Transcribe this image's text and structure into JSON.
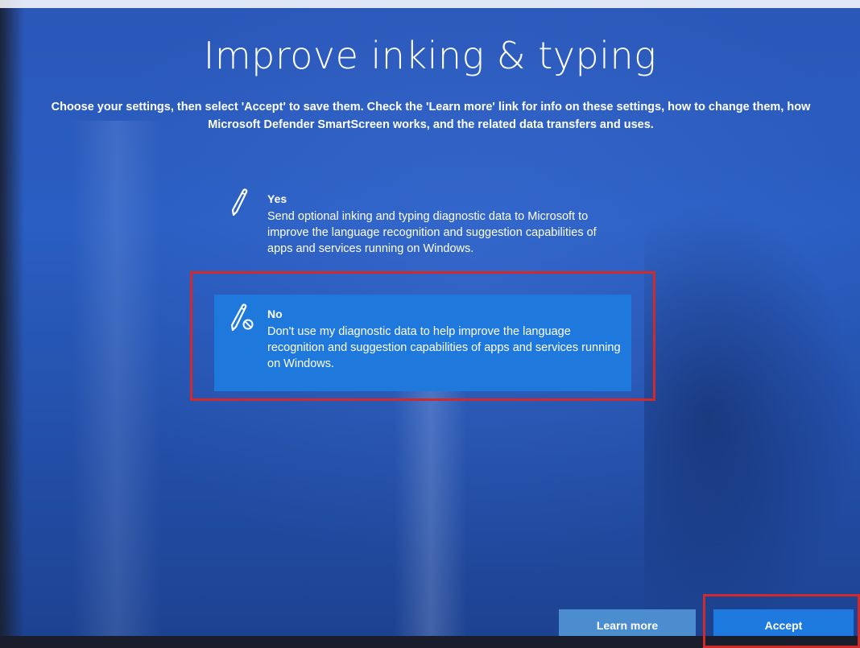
{
  "page": {
    "title": "Improve inking & typing",
    "subtitle": "Choose your settings, then select 'Accept' to save them. Check the 'Learn more' link for info on these settings, how to change them, how Microsoft Defender SmartScreen works, and the related data transfers and uses."
  },
  "options": [
    {
      "label": "Yes",
      "description": "Send optional inking and typing diagnostic data to Microsoft to improve the language recognition and suggestion capabilities of apps and services running on Windows.",
      "icon": "pen-icon",
      "selected": false
    },
    {
      "label": "No",
      "description": "Don't use my diagnostic data to help improve the language recognition and suggestion capabilities of apps and services running on Windows.",
      "icon": "pen-blocked-icon",
      "selected": true
    }
  ],
  "buttons": {
    "learn_more": "Learn more",
    "accept": "Accept"
  },
  "colors": {
    "background": "#2a5ec2",
    "selected_option": "#1f78dc",
    "accept_button": "#1f7ae0",
    "learn_more_button": "#4b8dcf",
    "annotation_box": "#d12a2a"
  }
}
